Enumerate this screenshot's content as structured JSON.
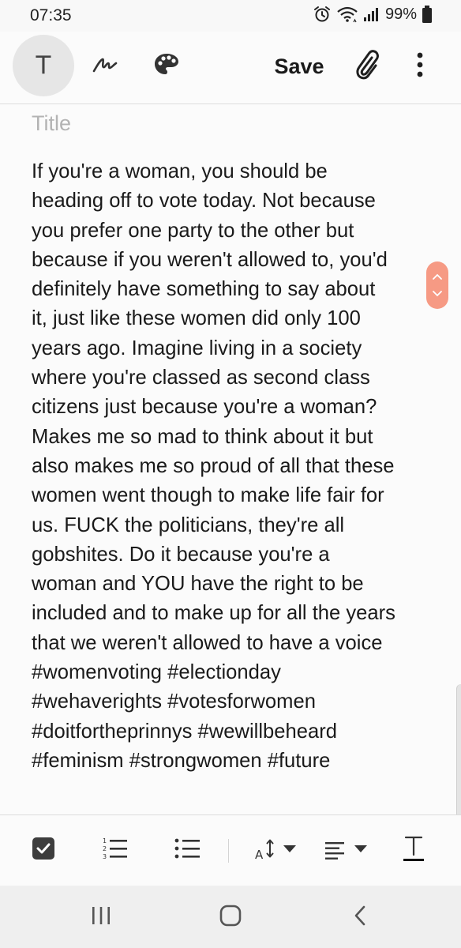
{
  "status_bar": {
    "time": "07:35",
    "battery": "99%",
    "icons": [
      "alarm-icon",
      "wifi-icon",
      "signal-icon",
      "battery-icon"
    ]
  },
  "toolbar": {
    "text_mode_label": "T",
    "save_label": "Save",
    "icons": [
      "pen-icon",
      "palette-icon",
      "paperclip-icon",
      "more-vert-icon"
    ]
  },
  "note": {
    "title_placeholder": "Title",
    "body": "If you're a woman, you should be\nheading off to vote today. Not because\nyou prefer one party to the other but\nbecause if you weren't allowed to, you'd\ndefinitely have something to say about\nit, just like these women did only 100\nyears ago. Imagine living in a society\nwhere you're classed as second class\ncitizens just because you're a woman?\nMakes me so mad to think about it but\nalso makes me so proud of all that these\nwomen went though to make life fair for\nus. FUCK the politicians, they're all\ngobshites. Do it because you're a\nwoman and YOU have the right to be\nincluded and to make up for all the years\nthat we weren't allowed to have a voice\n#womenvoting #electionday\n#wehaverights #votesforwomen\n#doitfortheprinnys #wewillbeheard\n#feminism #strongwomen #future"
  },
  "format_bar": {
    "icons": [
      "checkbox-icon",
      "numbered-list-icon",
      "bullet-list-icon",
      "font-size-icon",
      "align-icon",
      "text-style-icon"
    ]
  },
  "nav_bar": {
    "icons": [
      "recents-icon",
      "home-icon",
      "back-icon"
    ]
  },
  "colors": {
    "scroll_handle": "#f69a84",
    "background": "#fbfbfb",
    "text": "#1a1a1a",
    "title_placeholder": "#b3b3b3"
  }
}
